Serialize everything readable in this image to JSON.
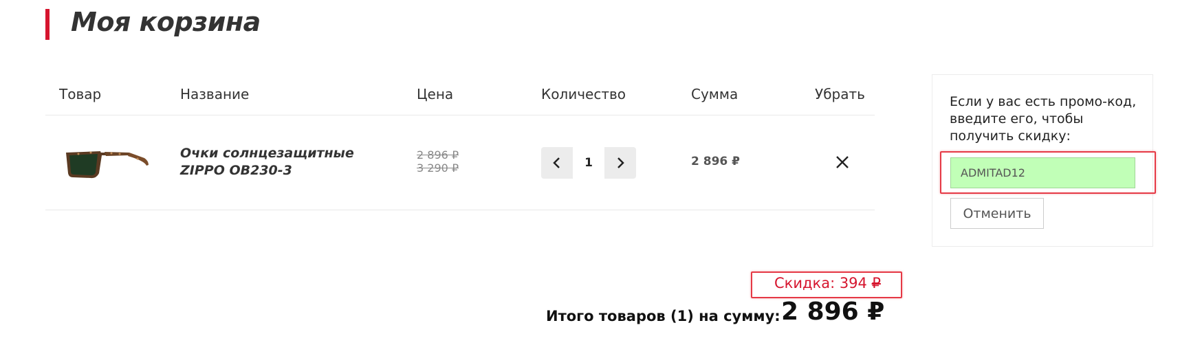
{
  "page": {
    "title": "Моя корзина"
  },
  "table": {
    "headers": [
      "Товар",
      "Название",
      "Цена",
      "Количество",
      "Сумма",
      "Убрать"
    ],
    "row": {
      "image_icon": "sunglasses-image",
      "name": "Очки солнцезащитные ZIPPO OB230-3",
      "price": "2 896 ₽",
      "old_price": "3 290 ₽",
      "quantity": "1",
      "sum": "2 896 ₽",
      "remove_icon": "close-icon"
    }
  },
  "promo": {
    "text": "Если у вас есть промо-код, введите его, чтобы получить скидку:",
    "code_value": "ADMITAD12",
    "cancel_label": "Отменить"
  },
  "summary": {
    "discount_label": "Скидка: 394 ",
    "discount_currency": "₽",
    "total_label": "Итого товаров (1) на сумму:",
    "total_value": "2 896 ₽"
  },
  "colors": {
    "accent": "#d6152e",
    "highlight_border": "#e53945",
    "promo_input_bg": "#c1ffb7"
  }
}
